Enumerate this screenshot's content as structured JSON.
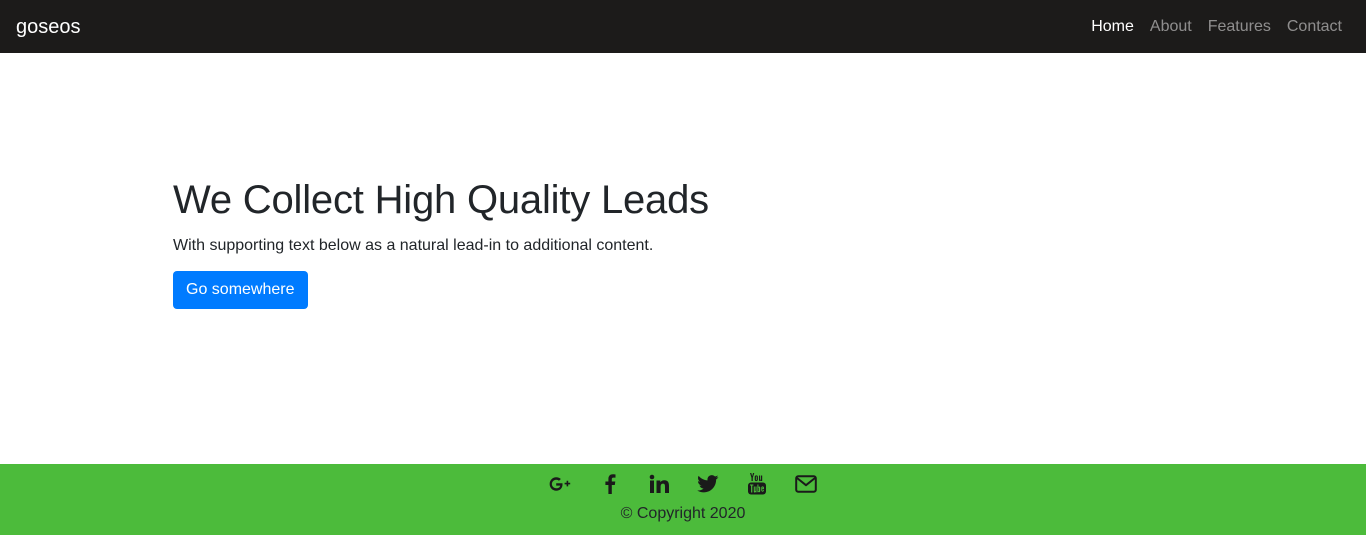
{
  "navbar": {
    "brand": "goseos",
    "links": [
      "Home",
      "About",
      "Features",
      "Contact"
    ],
    "active": "Home"
  },
  "hero": {
    "title": "We Collect High Quality Leads",
    "text": "With supporting text below as a natural lead-in to additional content.",
    "button_label": "Go somewhere"
  },
  "footer": {
    "social_icons": [
      "google-plus-icon",
      "facebook-icon",
      "linkedin-icon",
      "twitter-icon",
      "youtube-icon",
      "envelope-icon"
    ],
    "copyright": "© Copyright 2020"
  },
  "colors": {
    "navbar_bg": "#1c1b1a",
    "primary": "#007bff",
    "footer_bg": "#4cbb3b"
  }
}
